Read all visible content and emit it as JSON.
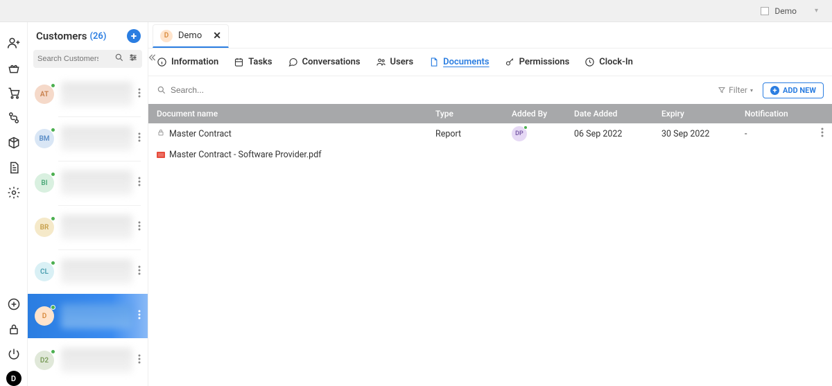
{
  "topbar": {
    "account_label": "Demo"
  },
  "listpanel": {
    "title": "Customers",
    "count": "(26)",
    "search_placeholder": "Search Customers",
    "customers": [
      {
        "initials": "AT",
        "bg": "#f5d9c9",
        "fg": "#c77f4b",
        "selected": false
      },
      {
        "initials": "BM",
        "bg": "#d9e6f5",
        "fg": "#5a8dc7",
        "selected": false
      },
      {
        "initials": "BI",
        "bg": "#d9f0e0",
        "fg": "#4ca878",
        "selected": false
      },
      {
        "initials": "BR",
        "bg": "#f5e9c9",
        "fg": "#c7a04b",
        "selected": false
      },
      {
        "initials": "CL",
        "bg": "#d9f0f5",
        "fg": "#4b9fb0",
        "selected": false
      },
      {
        "initials": "D",
        "bg": "#ffe4cc",
        "fg": "#d98c3f",
        "selected": true
      },
      {
        "initials": "D2",
        "bg": "#e0e8d9",
        "fg": "#7a9c5a",
        "selected": false
      }
    ]
  },
  "doc_tab": {
    "initial": "D",
    "label": "Demo"
  },
  "subtabs": [
    {
      "key": "information",
      "label": "Information",
      "icon": "info"
    },
    {
      "key": "tasks",
      "label": "Tasks",
      "icon": "calendar"
    },
    {
      "key": "conversations",
      "label": "Conversations",
      "icon": "chat"
    },
    {
      "key": "users",
      "label": "Users",
      "icon": "users"
    },
    {
      "key": "documents",
      "label": "Documents",
      "icon": "file",
      "active": true
    },
    {
      "key": "permissions",
      "label": "Permissions",
      "icon": "key"
    },
    {
      "key": "clockin",
      "label": "Clock-In",
      "icon": "clock"
    }
  ],
  "toolbar": {
    "search_placeholder": "Search...",
    "filter_label": "Filter",
    "add_label": "ADD NEW"
  },
  "table": {
    "headers": {
      "name": "Document name",
      "type": "Type",
      "added_by": "Added By",
      "date_added": "Date Added",
      "expiry": "Expiry",
      "notification": "Notification"
    },
    "rows": [
      {
        "name": "Master Contract",
        "type": "Report",
        "added_by": "DP",
        "date_added": "06 Sep 2022",
        "expiry": "30 Sep 2022",
        "notification": "-",
        "attachment": "Master Contract - Software Provider.pdf"
      }
    ]
  }
}
